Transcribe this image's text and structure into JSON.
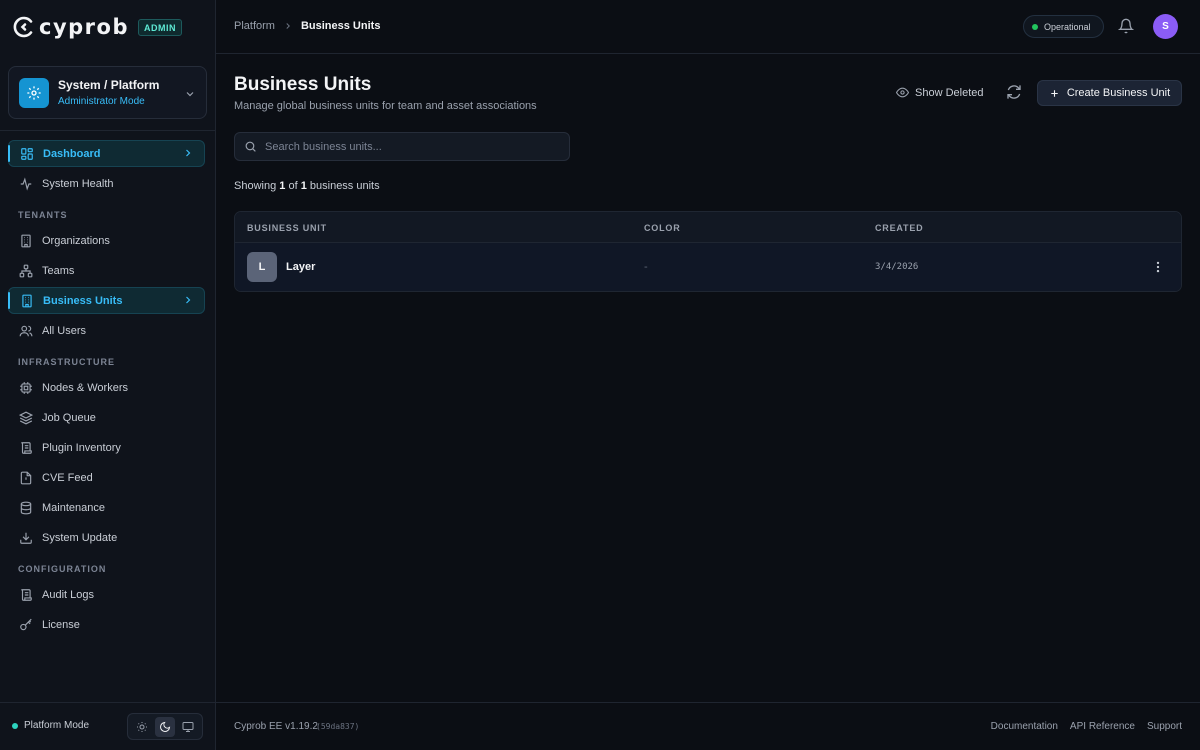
{
  "brand": {
    "name": "cyprob",
    "badge": "ADMIN"
  },
  "context": {
    "title": "System / Platform",
    "subtitle": "Administrator Mode"
  },
  "sidebar": {
    "items": [
      {
        "label": "Dashboard",
        "icon": "dashboard-icon",
        "active": true
      },
      {
        "label": "System Health",
        "icon": "activity-icon"
      }
    ],
    "sections": [
      {
        "label": "TENANTS",
        "items": [
          {
            "label": "Organizations",
            "icon": "building-icon"
          },
          {
            "label": "Teams",
            "icon": "network-icon"
          },
          {
            "label": "Business Units",
            "icon": "business-unit-icon",
            "active": true
          },
          {
            "label": "All Users",
            "icon": "users-icon"
          }
        ]
      },
      {
        "label": "INFRASTRUCTURE",
        "items": [
          {
            "label": "Nodes & Workers",
            "icon": "cpu-icon"
          },
          {
            "label": "Job Queue",
            "icon": "layers-icon"
          },
          {
            "label": "Plugin Inventory",
            "icon": "scroll-icon"
          },
          {
            "label": "CVE Feed",
            "icon": "alert-file-icon"
          },
          {
            "label": "Maintenance",
            "icon": "database-icon"
          },
          {
            "label": "System Update",
            "icon": "download-icon"
          }
        ]
      },
      {
        "label": "CONFIGURATION",
        "items": [
          {
            "label": "Audit Logs",
            "icon": "scroll-text-icon"
          },
          {
            "label": "License",
            "icon": "key-icon"
          }
        ]
      }
    ],
    "footer": {
      "mode_label": "Platform Mode"
    }
  },
  "header": {
    "breadcrumb": {
      "parent": "Platform",
      "current": "Business Units"
    },
    "status": "Operational",
    "avatar_initial": "S"
  },
  "main": {
    "title": "Business Units",
    "subtitle": "Manage global business units for team and asset associations",
    "show_deleted_label": "Show Deleted",
    "create_label": "Create Business Unit",
    "search_placeholder": "Search business units...",
    "showing": {
      "prefix": "Showing",
      "current": "1",
      "of": "of",
      "total": "1",
      "suffix": "business units"
    },
    "table": {
      "columns": [
        "BUSINESS UNIT",
        "COLOR",
        "CREATED"
      ],
      "rows": [
        {
          "initial": "L",
          "name": "Layer",
          "color": "-",
          "created": "3/4/2026"
        }
      ]
    }
  },
  "footer": {
    "version": "Cyprob EE v1.19.2",
    "commit": "(59da837)",
    "links": [
      "Documentation",
      "API Reference",
      "Support"
    ]
  },
  "colors": {
    "accent": "#38bdf8",
    "status_ok": "#22c55e",
    "avatar": "#8b5cf6",
    "background": "#0b0e14"
  }
}
